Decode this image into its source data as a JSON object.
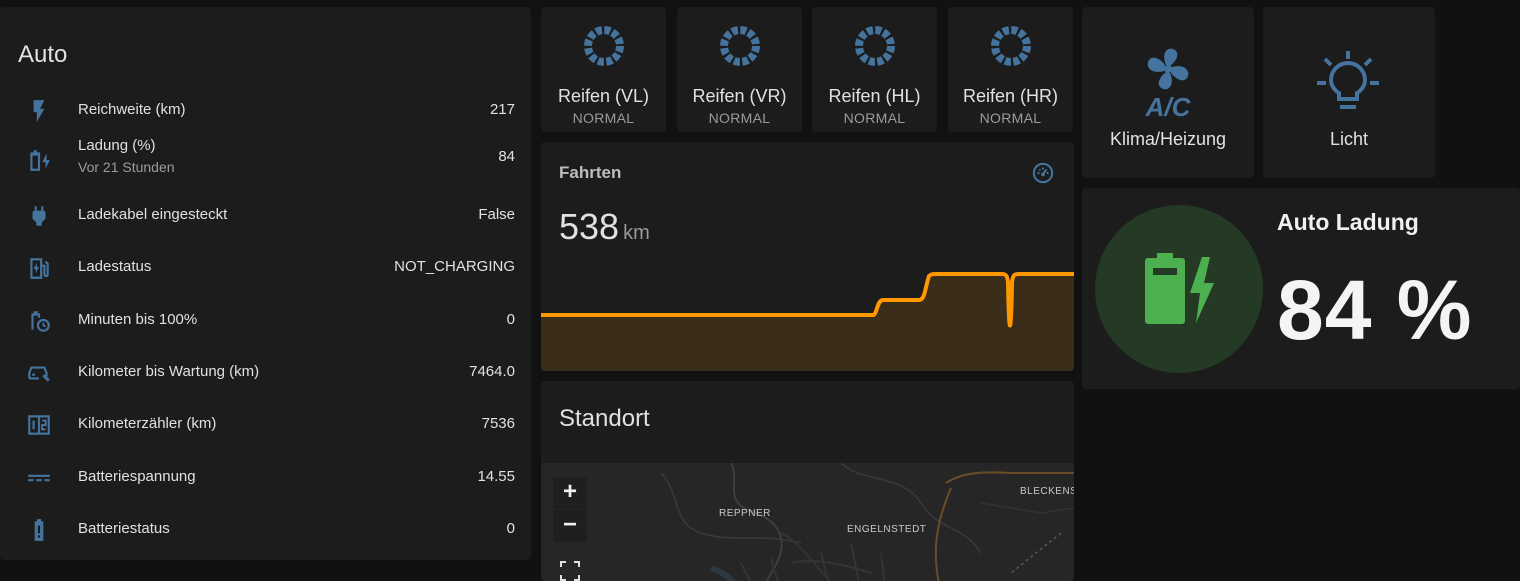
{
  "auto": {
    "title": "Auto",
    "rows": [
      {
        "label": "Reichweite (km)",
        "value": "217",
        "icon": "flash-icon"
      },
      {
        "label": "Ladung (%)",
        "secondary": "Vor 21 Stunden",
        "value": "84",
        "icon": "battery-charging-icon"
      },
      {
        "label": "Ladekabel eingesteckt",
        "value": "False",
        "icon": "power-plug-icon"
      },
      {
        "label": "Ladestatus",
        "value": "NOT_CHARGING",
        "icon": "ev-station-icon"
      },
      {
        "label": "Minuten bis 100%",
        "value": "0",
        "icon": "battery-clock-icon"
      },
      {
        "label": "Kilometer bis Wartung (km)",
        "value": "7464.0",
        "icon": "car-wrench-icon"
      },
      {
        "label": "Kilometerzähler (km)",
        "value": "7536",
        "icon": "counter-icon"
      },
      {
        "label": "Batteriespannung",
        "value": "14.55",
        "icon": "current-dc-icon"
      },
      {
        "label": "Batteriestatus",
        "value": "0",
        "icon": "battery-alert-icon"
      }
    ]
  },
  "tires": [
    {
      "label": "Reifen (VL)",
      "state": "NORMAL"
    },
    {
      "label": "Reifen (VR)",
      "state": "NORMAL"
    },
    {
      "label": "Reifen (HL)",
      "state": "NORMAL"
    },
    {
      "label": "Reifen (HR)",
      "state": "NORMAL"
    }
  ],
  "buttons": {
    "climate": {
      "label": "Klima/Heizung",
      "icon": "fan-ac-icon"
    },
    "light": {
      "label": "Licht",
      "icon": "lightbulb-on-icon"
    }
  },
  "fahrten": {
    "title": "Fahrten",
    "value": "538",
    "unit": "km",
    "icon": "speedometer-icon",
    "line_color": "#ff9800"
  },
  "standort": {
    "title": "Standort",
    "zoom_in": "+",
    "zoom_out": "−",
    "places": [
      "REPPNER",
      "ENGELNSTEDT",
      "BLECKENST"
    ]
  },
  "ladung": {
    "title": "Auto Ladung",
    "value": "84 %",
    "color": "#4caf50"
  },
  "colors": {
    "icon_blue": "#44739e",
    "accent_orange": "#ff9800"
  }
}
